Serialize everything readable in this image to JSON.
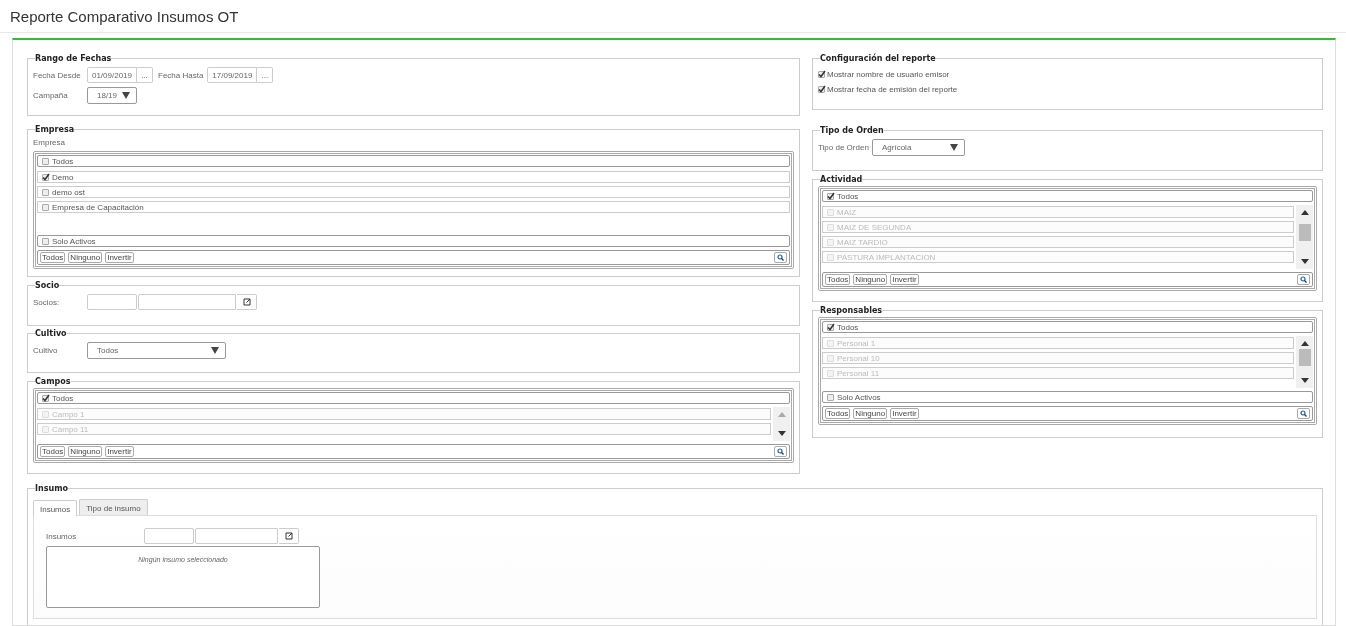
{
  "title": "Reporte Comparativo Insumos OT",
  "rango_fechas": {
    "legend": "Rango de Fechas",
    "fecha_desde": {
      "label": "Fecha Desde",
      "value": "01/09/2019",
      "button": "..."
    },
    "fecha_hasta": {
      "label": "Fecha Hasta",
      "value": "17/09/2019",
      "button": "..."
    },
    "campana": {
      "label": "Campaña",
      "value": "18/19"
    }
  },
  "empresa": {
    "legend": "Empresa",
    "label": "Empresa",
    "todos": {
      "label": "Todos",
      "checked": false
    },
    "items": [
      {
        "label": "Demo",
        "checked": true,
        "disabled": false
      },
      {
        "label": "demo ost",
        "checked": false,
        "disabled": false
      },
      {
        "label": "Empresa de Capacitación",
        "checked": false,
        "disabled": false
      }
    ],
    "solo_activos": {
      "label": "Solo Activos",
      "checked": false
    },
    "actions": [
      "Todos",
      "Ninguno",
      "Invertir"
    ]
  },
  "socio": {
    "legend": "Socio",
    "label": "Socios:"
  },
  "cultivo": {
    "legend": "Cultivo",
    "label": "Cultivo",
    "value": "Todos"
  },
  "campos": {
    "legend": "Campos",
    "todos": {
      "label": "Todos",
      "checked": true
    },
    "items": [
      {
        "label": "Campo 1",
        "checked": false,
        "disabled": true
      },
      {
        "label": "Campo 11",
        "checked": false,
        "disabled": true
      }
    ],
    "actions": [
      "Todos",
      "Ninguno",
      "Invertir"
    ]
  },
  "configuracion": {
    "legend": "Configuración del reporte",
    "options": [
      {
        "label": "Mostrar nombre de usuario emisor",
        "checked": true
      },
      {
        "label": "Mostrar fecha de emisión del reporte",
        "checked": true
      }
    ]
  },
  "tipo_orden": {
    "legend": "Tipo de Orden",
    "label": "Tipo de Orden",
    "value": "Agrícola"
  },
  "actividad": {
    "legend": "Actividad",
    "todos": {
      "label": "Todos",
      "checked": true
    },
    "items": [
      {
        "label": "MAIZ",
        "checked": false,
        "disabled": true
      },
      {
        "label": "MAIZ DE SEGUNDA",
        "checked": false,
        "disabled": true
      },
      {
        "label": "MAIZ TARDIO",
        "checked": false,
        "disabled": true
      },
      {
        "label": "PASTURA IMPLANTACION",
        "checked": false,
        "disabled": true
      }
    ],
    "actions": [
      "Todos",
      "Ninguno",
      "Invertir"
    ]
  },
  "responsables": {
    "legend": "Responsables",
    "todos": {
      "label": "Todos",
      "checked": true
    },
    "items": [
      {
        "label": "Personal 1",
        "checked": false,
        "disabled": true
      },
      {
        "label": "Personal 10",
        "checked": false,
        "disabled": true
      },
      {
        "label": "Personal 11",
        "checked": false,
        "disabled": true
      }
    ],
    "solo_activos": {
      "label": "Solo Activos",
      "checked": false
    },
    "actions": [
      "Todos",
      "Ninguno",
      "Invertir"
    ]
  },
  "insumo": {
    "legend": "Insumo",
    "tabs": [
      {
        "label": "Insumos",
        "selected": true
      },
      {
        "label": "Tipo de insumo",
        "selected": false
      }
    ],
    "label": "Insumos",
    "empty_message": "Ningún insumo seleccionado"
  }
}
